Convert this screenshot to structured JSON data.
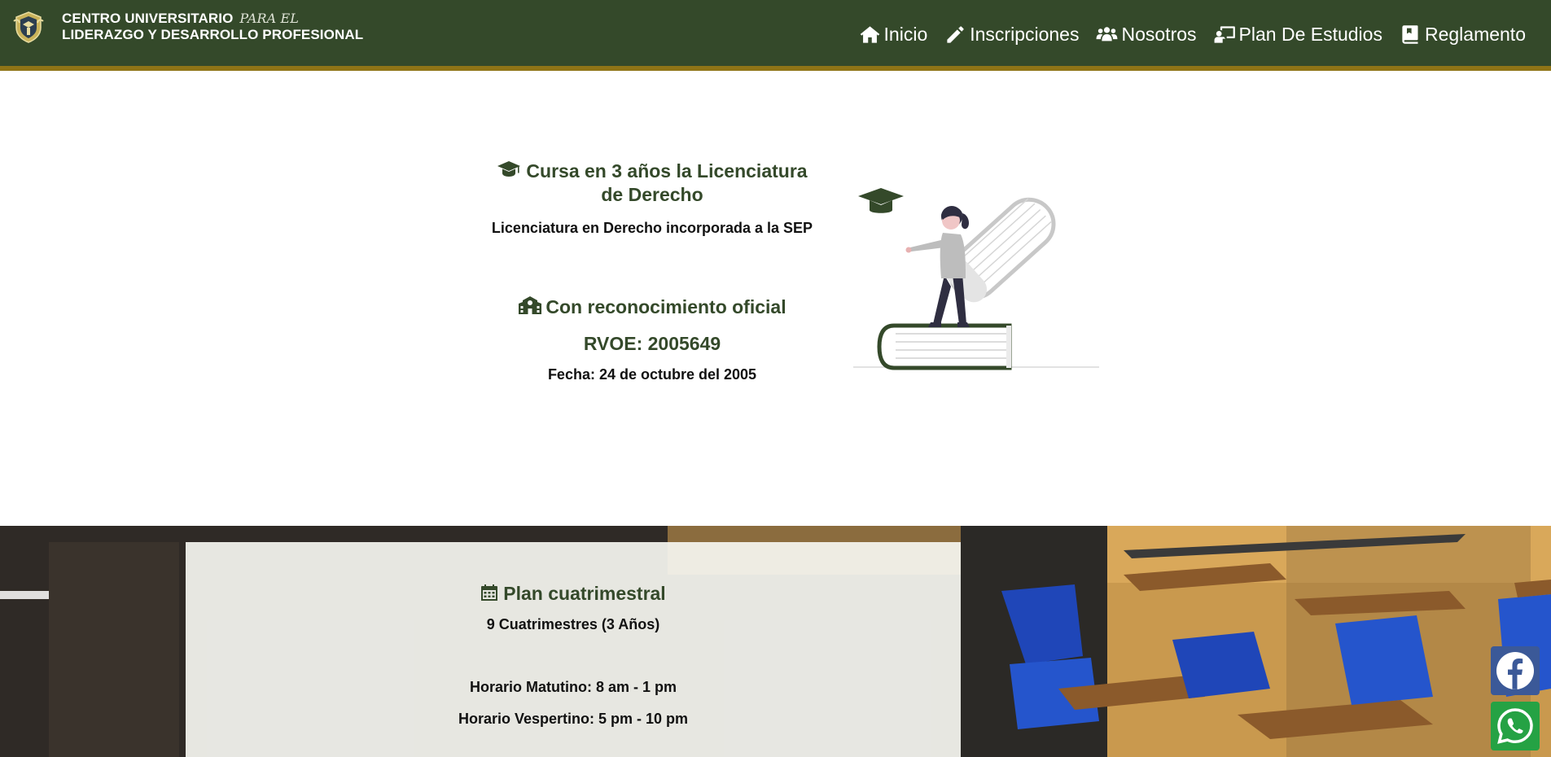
{
  "header": {
    "brand_line1": "CENTRO UNIVERSITARIO",
    "brand_script": "PARA EL",
    "brand_line2": "LIDERAZGO Y DESARROLLO PROFESIONAL",
    "nav": [
      {
        "label": "Inicio",
        "icon": "home-icon"
      },
      {
        "label": "Inscripciones",
        "icon": "pencil-icon"
      },
      {
        "label": "Nosotros",
        "icon": "users-icon"
      },
      {
        "label": "Plan De Estudios",
        "icon": "teacher-icon"
      },
      {
        "label": "Reglamento",
        "icon": "book-icon"
      }
    ]
  },
  "hero": {
    "title": "Cursa en 3 años la Licenciatura de Derecho",
    "subtitle": "Licenciatura en Derecho incorporada a la SEP",
    "official_title": "Con reconocimiento oficial",
    "rvoe": "RVOE: 2005649",
    "date": "Fecha: 24 de octubre del 2005"
  },
  "plan": {
    "title": "Plan cuatrimestral",
    "duration": "9 Cuatrimestres (3 Años)",
    "morning": "Horario Matutino: 8 am - 1 pm",
    "evening": "Horario Vespertino: 5 pm - 10 pm"
  },
  "colors": {
    "primary": "#34492a",
    "accent": "#8f7416",
    "facebook": "#3b5998",
    "whatsapp": "#25a244"
  }
}
